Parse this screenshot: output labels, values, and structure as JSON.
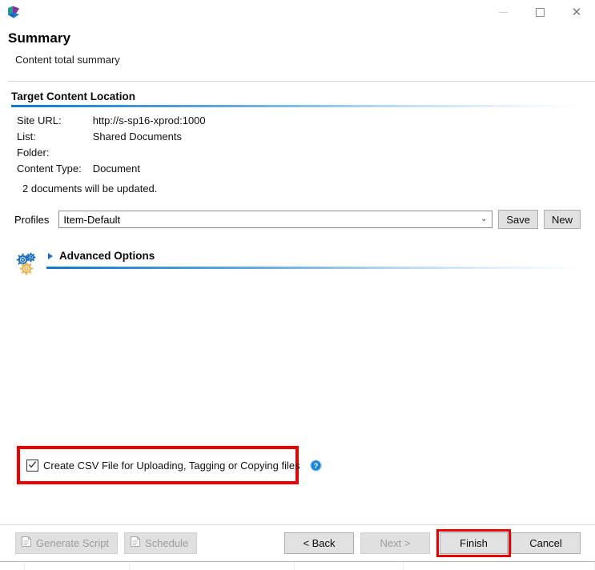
{
  "window": {
    "logo_icon": "app-cube-logo",
    "controls": [
      {
        "name": "minimize",
        "glyph": "minimize-icon",
        "disabled": true
      },
      {
        "name": "maximize",
        "glyph": "maximize-icon",
        "disabled": false
      },
      {
        "name": "close",
        "glyph": "close-icon",
        "label": "✕",
        "disabled": false
      }
    ]
  },
  "header": {
    "title": "Summary",
    "subtitle": "Content total summary"
  },
  "section": {
    "title": "Target Content Location",
    "fields": [
      {
        "label": "Site URL:",
        "value": "http://s-sp16-xprod:1000"
      },
      {
        "label": "List:",
        "value": "Shared Documents"
      },
      {
        "label": "Folder:",
        "value": ""
      },
      {
        "label": "Content Type:",
        "value": "Document"
      }
    ],
    "note": "2 documents will be updated."
  },
  "profiles": {
    "label": "Profiles",
    "selected": "Item-Default",
    "chevron": "⌄",
    "save_label": "Save",
    "new_label": "New"
  },
  "advanced": {
    "label": "Advanced Options",
    "expanded": false,
    "gears_icon": "gears-icon"
  },
  "csv": {
    "checked": true,
    "label": "Create CSV File for Uploading, Tagging or Copying files",
    "help_icon": "help-circle-icon",
    "highlight_color": "#ef0000"
  },
  "footer": {
    "generate_script_label": "Generate Script",
    "generate_script_disabled": true,
    "schedule_label": "Schedule",
    "schedule_disabled": true,
    "back_label": "< Back",
    "next_label": "Next >",
    "next_disabled": true,
    "finish_label": "Finish",
    "finish_highlighted": true,
    "cancel_label": "Cancel"
  },
  "colors": {
    "accent_blue": "#1277c8",
    "highlight_red": "#ef0000",
    "gear_blue": "#1b6ec2",
    "gear_gold": "#f0c060",
    "help_blue": "#1b86d6"
  }
}
